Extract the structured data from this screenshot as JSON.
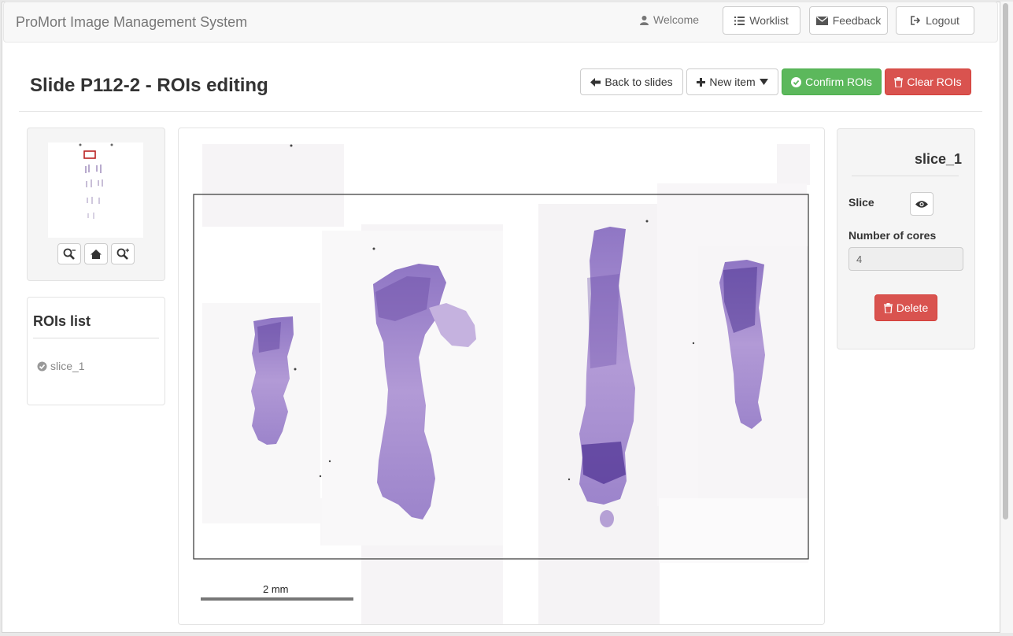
{
  "navbar": {
    "brand": "ProMort Image Management System",
    "welcome": "Welcome",
    "worklist": "Worklist",
    "feedback": "Feedback",
    "logout": "Logout"
  },
  "page": {
    "title": "Slide P112-2 - ROIs editing"
  },
  "toolbar": {
    "back_label": "Back to slides",
    "new_item_label": "New item",
    "confirm_label": "Confirm ROIs",
    "clear_label": "Clear ROIs"
  },
  "rois_list": {
    "title": "ROIs list",
    "items": [
      {
        "label": "slice_1"
      }
    ]
  },
  "viewer": {
    "scale_label": "2 mm"
  },
  "details": {
    "title": "slice_1",
    "slice_label": "Slice",
    "cores_label": "Number of cores",
    "cores_value": "4",
    "delete_label": "Delete"
  },
  "colors": {
    "success": "#5cb85c",
    "danger": "#d9534f",
    "tissue": "#a98bd0",
    "tissue_dark": "#5a3f9a"
  },
  "icons": [
    "user-icon",
    "list-icon",
    "envelope-icon",
    "logout-icon",
    "arrow-left-icon",
    "plus-icon",
    "caret-down-icon",
    "check-circle-icon",
    "trash-icon",
    "zoom-out-icon",
    "home-icon",
    "zoom-in-icon",
    "eye-icon"
  ]
}
